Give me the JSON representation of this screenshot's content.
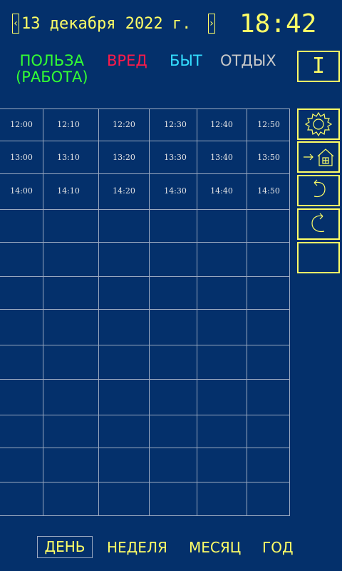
{
  "header": {
    "prev_arrow": "‹",
    "next_arrow": "›",
    "date": "13 декабря 2022 г.",
    "time": "18:42"
  },
  "categories": {
    "use_line1": "ПОЛЬЗА",
    "use_line2": "(РАБОТА)",
    "harm": "ВРЕД",
    "home": "БЫТ",
    "rest": "ОТДЫХ"
  },
  "info_button": "I",
  "schedule": {
    "rows": [
      [
        "12:00",
        "12:10",
        "12:20",
        "12:30",
        "12:40",
        "12:50"
      ],
      [
        "13:00",
        "13:10",
        "13:20",
        "13:30",
        "13:40",
        "13:50"
      ],
      [
        "14:00",
        "14:10",
        "14:20",
        "14:30",
        "14:40",
        "14:50"
      ]
    ]
  },
  "side_buttons": {
    "icons": [
      "gear-icon",
      "go-home-icon",
      "undo-icon",
      "redo-icon",
      "blank"
    ]
  },
  "tabs": {
    "day": "ДЕНЬ",
    "week": "НЕДЕЛЯ",
    "month": "МЕСЯЦ",
    "year": "ГОД"
  },
  "colors": {
    "background": "#04306b",
    "accent": "#ffff66",
    "use": "#33ff33",
    "harm": "#ff1a4a",
    "home": "#33ddff",
    "rest": "#c8c8c8"
  }
}
